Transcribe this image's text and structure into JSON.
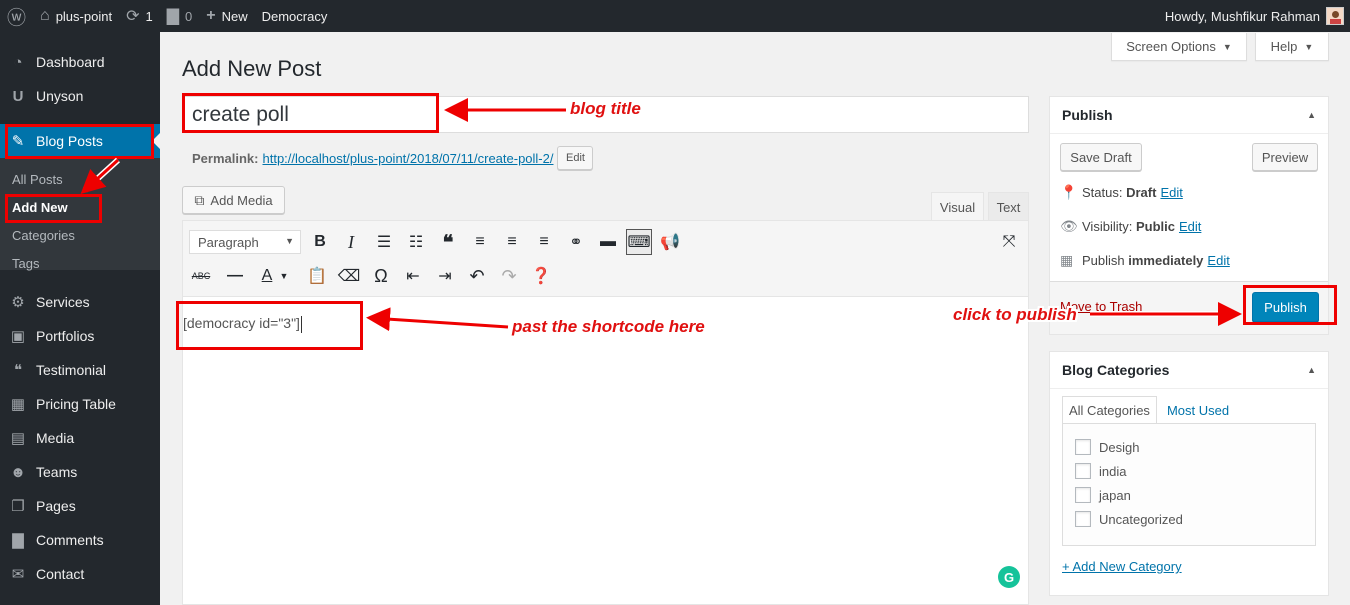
{
  "adminbar": {
    "site_name": "plus-point",
    "updates_count": "1",
    "comments_count": "0",
    "new_label": "New",
    "plugin_label": "Democracy",
    "greeting": "Howdy, Mushfikur Rahman"
  },
  "sidebar": {
    "items": [
      {
        "label": "Dashboard",
        "icon": "dashboard-icon"
      },
      {
        "label": "Unyson",
        "icon": "unyson-icon"
      },
      {
        "label": "Blog Posts",
        "icon": "pin-icon"
      },
      {
        "label": "Services",
        "icon": "services-icon"
      },
      {
        "label": "Portfolios",
        "icon": "portfolio-icon"
      },
      {
        "label": "Testimonial",
        "icon": "testimonial-icon"
      },
      {
        "label": "Pricing Table",
        "icon": "table-icon"
      },
      {
        "label": "Media",
        "icon": "media-icon"
      },
      {
        "label": "Teams",
        "icon": "teams-icon"
      },
      {
        "label": "Pages",
        "icon": "pages-icon"
      },
      {
        "label": "Comments",
        "icon": "comments-icon"
      },
      {
        "label": "Contact",
        "icon": "mail-icon"
      }
    ],
    "submenu": [
      "All Posts",
      "Add New",
      "Categories",
      "Tags"
    ]
  },
  "screen_options": "Screen Options",
  "help": "Help",
  "page_title": "Add New Post",
  "post_title_value": "create poll",
  "permalink": {
    "label": "Permalink:",
    "url": "http://localhost/plus-point/2018/07/11/create-poll-2/",
    "edit": "Edit"
  },
  "add_media": "Add Media",
  "editor_tabs": {
    "visual": "Visual",
    "text": "Text"
  },
  "format_select": "Paragraph",
  "content": "[democracy id=\"3\"]",
  "publish_box": {
    "title": "Publish",
    "save_draft": "Save Draft",
    "preview": "Preview",
    "status_label": "Status:",
    "status_value": "Draft",
    "visibility_label": "Visibility:",
    "visibility_value": "Public",
    "publish_label": "Publish",
    "publish_value": "immediately",
    "edit": "Edit",
    "trash": "Move to Trash",
    "publish_button": "Publish"
  },
  "categories_box": {
    "title": "Blog Categories",
    "tab_all": "All Categories",
    "tab_used": "Most Used",
    "items": [
      "Desigh",
      "india",
      "japan",
      "Uncategorized"
    ],
    "add_new": "+ Add New Category"
  },
  "annotations": {
    "title": "blog title",
    "shortcode": "past the shortcode here",
    "publish": "click to publish"
  },
  "colors": {
    "accent": "#0073aa",
    "publish": "#0085ba",
    "sidebar": "#23282d",
    "annotation": "#e01010"
  }
}
